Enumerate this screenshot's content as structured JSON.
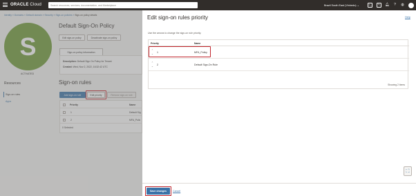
{
  "topnav": {
    "logo_brand": "ORACLE",
    "logo_product": "Cloud",
    "search_placeholder": "Search resources, services, documentation, and Marketplace",
    "region": "Brazil South East (Vinhedo)"
  },
  "breadcrumb": {
    "items": [
      "Identity",
      "Domains",
      "Default domain",
      "Security",
      "Sign-on policies"
    ],
    "current": "Sign-on policy details"
  },
  "policy": {
    "badge_letter": "S",
    "status": "ACTIVATED",
    "title": "Default Sign-On Policy",
    "edit_button": "Edit sign-on policy",
    "deactivate_button": "Deactivate sign-on policy",
    "info_tab": "Sign-on policy information",
    "description_label": "Description:",
    "description_value": "Default Sign On Policy for Tenant",
    "created_label": "Created:",
    "created_value": "Wed, Nov 2, 2022, 16:32:42 UTC"
  },
  "resources": {
    "title": "Resources",
    "items": [
      "Sign-on rules",
      "Apps"
    ]
  },
  "rules_section": {
    "title": "Sign-on rules",
    "add_button": "Add sign-on rule",
    "edit_priority_button": "Edit priority",
    "remove_button": "Remove sign-on rule",
    "columns": [
      "Priority",
      "Name"
    ],
    "rows": [
      {
        "priority": "1",
        "name": "Default Sig"
      },
      {
        "priority": "2",
        "name": "MFA_Polic"
      }
    ],
    "selected": "0 Selected"
  },
  "panel": {
    "title": "Edit sign-on rules priority",
    "help": "Help",
    "hint": "Use the arrows to change the sign-on rule priority.",
    "columns": [
      "Priority",
      "Name"
    ],
    "rows": [
      {
        "priority": "1",
        "name": "MFA_Policy"
      },
      {
        "priority": "2",
        "name": "Default Sign-On Rule"
      }
    ],
    "showing": "Showing 2 items",
    "save_button": "Save changes",
    "cancel": "Cancel"
  }
}
